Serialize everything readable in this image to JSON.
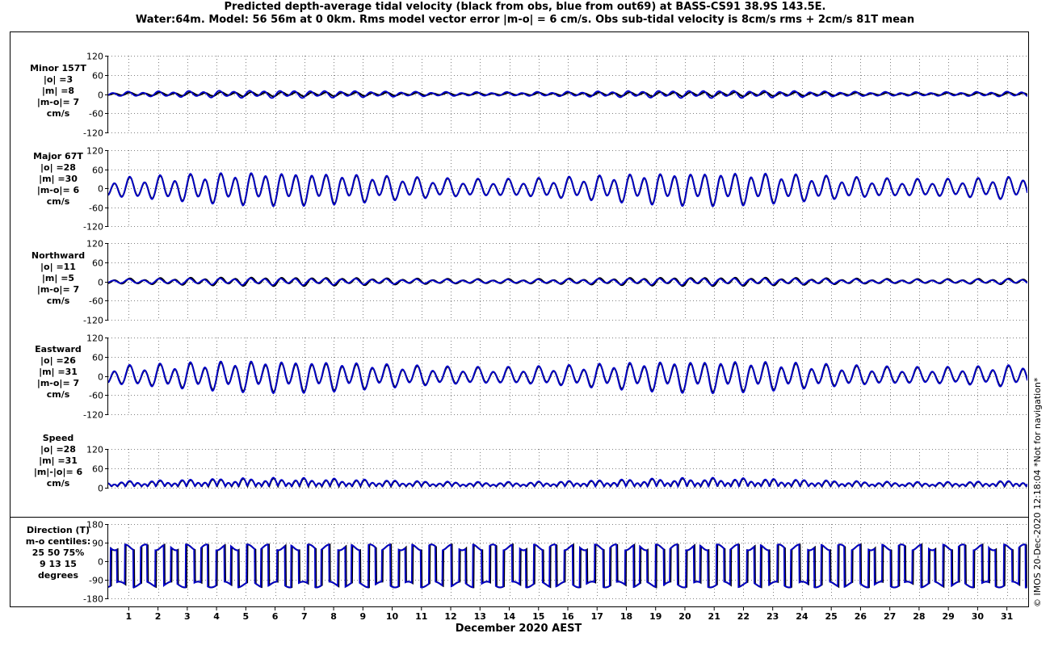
{
  "title_line1": "Predicted depth-average tidal velocity (black from obs, blue from out69) at BASS-CS91 38.9S 143.5E.",
  "title_line2": "Water:64m. Model: 56 56m at 0 0km. Rms model vector error |m-o| = 6 cm/s. Obs sub-tidal velocity is 8cm/s rms + 2cm/s 81T mean",
  "side_text": "© IMOS 20-Dec-2020 12:18:04  *Not for navigation*",
  "colors": {
    "obs": "#000000",
    "model": "#0000cc",
    "grid": "#808080",
    "frame": "#000000"
  },
  "chart_data": [
    {
      "type": "line",
      "id": "minor",
      "label_lines": [
        "Minor 157T",
        "|o| =3",
        "|m| =8",
        "|m-o|= 7",
        "cm/s"
      ],
      "ylim": [
        -120,
        120
      ],
      "yticks": [
        -120,
        -60,
        0,
        60,
        120
      ],
      "series": [
        {
          "name": "obs",
          "semidiurnal_amp": 5,
          "diurnal_amp": 2,
          "phase_deg": 0
        },
        {
          "name": "out69",
          "semidiurnal_amp": 9,
          "diurnal_amp": 3,
          "phase_deg": 40
        }
      ]
    },
    {
      "type": "line",
      "id": "major",
      "label_lines": [
        "Major 67T",
        "|o| =28",
        "|m| =30",
        "|m-o|= 6",
        "cm/s"
      ],
      "ylim": [
        -120,
        120
      ],
      "yticks": [
        -120,
        -60,
        0,
        60,
        120
      ],
      "series": [
        {
          "name": "obs",
          "semidiurnal_amp": 38,
          "diurnal_amp": 14,
          "phase_deg": 0
        },
        {
          "name": "out69",
          "semidiurnal_amp": 40,
          "diurnal_amp": 15,
          "phase_deg": 4
        }
      ]
    },
    {
      "type": "line",
      "id": "northward",
      "label_lines": [
        "Northward",
        "|o| =11",
        "|m| =5",
        "|m-o|= 7",
        "cm/s"
      ],
      "ylim": [
        -120,
        120
      ],
      "yticks": [
        -120,
        -60,
        0,
        60,
        120
      ],
      "series": [
        {
          "name": "obs",
          "semidiurnal_amp": 10,
          "diurnal_amp": 4,
          "phase_deg": 0
        },
        {
          "name": "out69",
          "semidiurnal_amp": 8,
          "diurnal_amp": 3,
          "phase_deg": 25
        }
      ]
    },
    {
      "type": "line",
      "id": "eastward",
      "label_lines": [
        "Eastward",
        "|o| =26",
        "|m| =31",
        "|m-o|= 7",
        "cm/s"
      ],
      "ylim": [
        -120,
        120
      ],
      "yticks": [
        -120,
        -60,
        0,
        60,
        120
      ],
      "series": [
        {
          "name": "obs",
          "semidiurnal_amp": 35,
          "diurnal_amp": 13,
          "phase_deg": 0
        },
        {
          "name": "out69",
          "semidiurnal_amp": 38,
          "diurnal_amp": 14,
          "phase_deg": 5
        }
      ]
    },
    {
      "type": "line",
      "id": "speed",
      "label_lines": [
        "Speed",
        "|o| =28",
        "|m| =31",
        "|m|-|o|= 6",
        "cm/s"
      ],
      "ylim": [
        0,
        120
      ],
      "yticks": [
        0,
        60,
        120
      ],
      "series": [
        {
          "name": "obs",
          "mean": 25,
          "semidiurnal_amp": 17,
          "diurnal_amp": 7,
          "phase_deg": 0
        },
        {
          "name": "out69",
          "mean": 27,
          "semidiurnal_amp": 18,
          "diurnal_amp": 8,
          "phase_deg": 5
        }
      ]
    },
    {
      "type": "line",
      "id": "direction",
      "label_lines": [
        "Direction (T)",
        "m-o centiles:",
        "25  50  75%",
        "9  13  15",
        "degrees"
      ],
      "ylim": [
        -180,
        180
      ],
      "yticks": [
        -180,
        -90,
        0,
        90,
        180
      ],
      "series": [
        {
          "name": "obs",
          "levels_deg": [
            67,
            -113
          ]
        },
        {
          "name": "out69",
          "levels_deg": [
            67,
            -113
          ]
        }
      ]
    }
  ],
  "xaxis": {
    "xlabel": "December 2020 AEST",
    "xlim_days": [
      0.3,
      31.7
    ],
    "day_ticks": [
      "1",
      "2",
      "3",
      "4",
      "5",
      "6",
      "7",
      "8",
      "9",
      "10",
      "11",
      "12",
      "13",
      "14",
      "15",
      "16",
      "17",
      "18",
      "19",
      "20",
      "21",
      "22",
      "23",
      "24",
      "25",
      "26",
      "27",
      "28",
      "29",
      "30",
      "31"
    ]
  }
}
